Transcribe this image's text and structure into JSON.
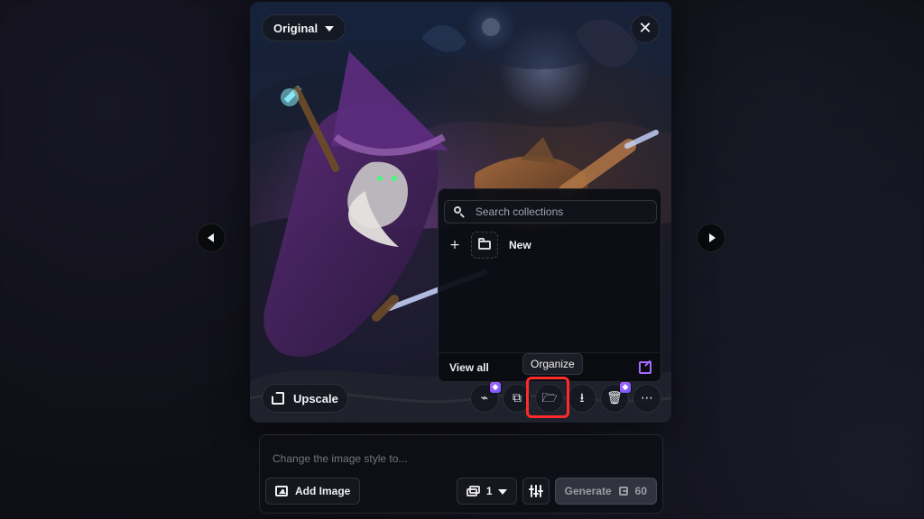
{
  "viewer": {
    "original_label": "Original",
    "close_symbol": "✕"
  },
  "actions": {
    "upscale_label": "Upscale",
    "tooltip_label": "Organize"
  },
  "organize_panel": {
    "search_placeholder": "Search collections",
    "new_label": "New",
    "view_all_label": "View all"
  },
  "prompt": {
    "placeholder": "Change the image style to...",
    "add_image_label": "Add Image",
    "image_count": "1",
    "generate_label": "Generate",
    "generate_cost": "60"
  },
  "icons": {
    "left_nav": "chevron-left-icon",
    "right_nav": "chevron-right-icon",
    "organize": "folder-open-icon"
  },
  "colors": {
    "highlight": "#ff2b2b",
    "accent": "#a56cff",
    "premium_badge": "#b061ff"
  }
}
